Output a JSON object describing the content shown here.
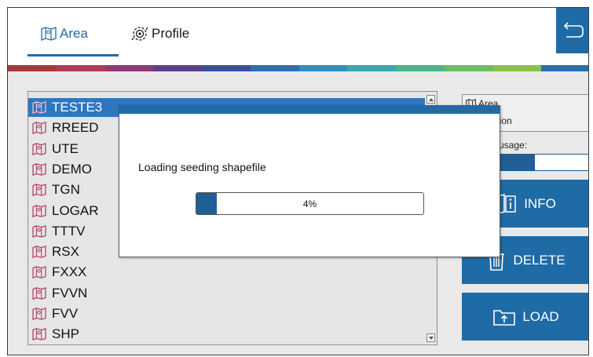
{
  "tabs": {
    "area_label": "Area",
    "profile_label": "Profile"
  },
  "rainbow_colors": [
    "#a53b3b",
    "#b23b56",
    "#8e3a74",
    "#5f3f8a",
    "#3a4f9a",
    "#2f6fb0",
    "#2e8fc0",
    "#3aa7b0",
    "#4fb48a",
    "#6dbb64",
    "#8bc04a",
    "#2a6fb0"
  ],
  "areas": {
    "items": [
      "TESTE3",
      "RREED",
      "UTE",
      "DEMO",
      "TGN",
      "LOGAR",
      "TTTV",
      "RSX",
      "FXXX",
      "FVVN",
      "FVV",
      "SHP"
    ],
    "selected_index": 0
  },
  "info_panel": {
    "area_label": "Area",
    "description_label": "scription",
    "usage_label": "usage:",
    "usage_fraction": 0.57
  },
  "actions": {
    "info_label": "INFO",
    "delete_label": "DELETE",
    "load_label": "LOAD"
  },
  "modal": {
    "message": "Loading seeding shapefile",
    "progress_percent": 4,
    "progress_text": "4%"
  },
  "colors": {
    "accent": "#1f6ba6",
    "selection": "#2d77c2",
    "progress": "#1f5f95"
  }
}
